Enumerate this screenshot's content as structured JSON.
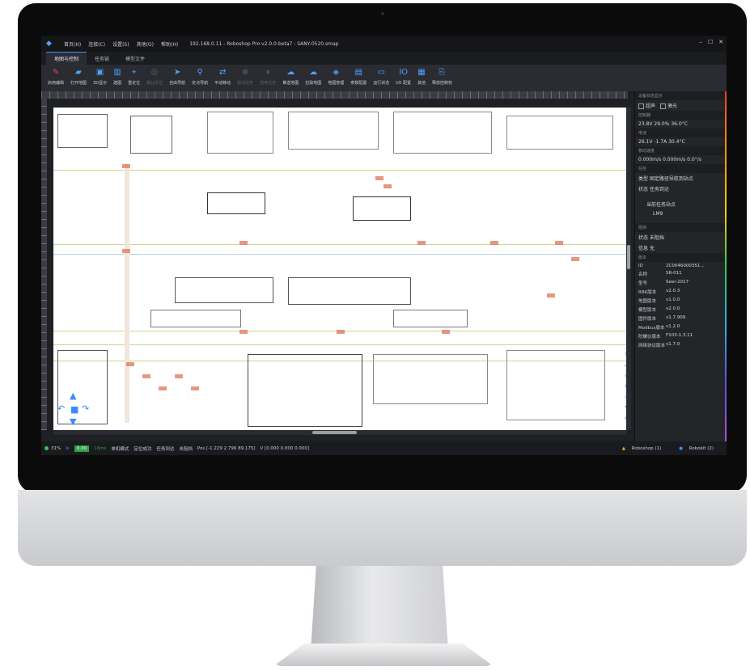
{
  "window": {
    "menus": [
      "首页(H)",
      "连接(C)",
      "设置(S)",
      "其他(O)",
      "帮助(H)"
    ],
    "title": "192.168.0.11 - Roboshop Pro v2.0.0-beta7 : SANY-0520.smap",
    "controls": [
      "–",
      "☐",
      "✕"
    ]
  },
  "tabs": [
    "地图与控制",
    "任务链",
    "模型文件"
  ],
  "toolbar": [
    {
      "label": "启用编辑",
      "icon": "pencil-icon"
    },
    {
      "label": "打开地图",
      "icon": "folder-icon"
    },
    {
      "label": "3D显示",
      "icon": "3d-icon"
    },
    {
      "label": "建图",
      "icon": "map-build-icon"
    },
    {
      "label": "重定位",
      "icon": "relocate-icon"
    },
    {
      "label": "确认定位",
      "icon": "confirm-icon"
    },
    {
      "label": "自由导航",
      "icon": "navigate-icon"
    },
    {
      "label": "定点导航",
      "icon": "pin-icon"
    },
    {
      "label": "平动移动",
      "icon": "move-icon"
    },
    {
      "label": "取消任务",
      "icon": "cancel-icon"
    },
    {
      "label": "暂停任务",
      "icon": "pause-icon"
    },
    {
      "label": "推送地图",
      "icon": "upload-icon"
    },
    {
      "label": "拉取地图",
      "icon": "download-icon"
    },
    {
      "label": "地图管理",
      "icon": "layers-icon"
    },
    {
      "label": "参数配置",
      "icon": "params-icon"
    },
    {
      "label": "运行状态",
      "icon": "monitor-icon"
    },
    {
      "label": "I/O 配置",
      "icon": "io-icon"
    },
    {
      "label": "其他",
      "icon": "grid-icon"
    },
    {
      "label": "释放控制权",
      "icon": "release-icon"
    }
  ],
  "panel": {
    "device_title": "设备状态显示",
    "checks": [
      "超声",
      "激光"
    ],
    "controller_title": "控制器",
    "controller": "23.8V   29.0%   36.0°C",
    "battery_title": "电池",
    "battery": "26.1V   -1.7A   30.4°C",
    "speed_title": "移动速度",
    "speed": "0.000m/s  0.000m/s  0.0°/s",
    "task_title": "任务",
    "task_type": "类型  固定路径导航到站点",
    "task_state": "状态  任务到达",
    "target_label": "当前任务站点",
    "target_value": "LM9",
    "block_title": "阻挡",
    "block_state": "状态  未阻挡",
    "block_info": "信息  无",
    "version_title": "版本",
    "versions": [
      {
        "k": "ID",
        "v": "2C0046000351..."
      },
      {
        "k": "名称",
        "v": "SR-011"
      },
      {
        "k": "型号",
        "v": "Seer-2017"
      },
      {
        "k": "RBK版本",
        "v": "v2.0.3"
      },
      {
        "k": "地图版本",
        "v": "v1.0.0"
      },
      {
        "k": "模型版本",
        "v": "v2.0.0"
      },
      {
        "k": "固件版本",
        "v": "v1.7.909"
      },
      {
        "k": "Modbus版本",
        "v": "v1.2.0"
      },
      {
        "k": "陀螺仪版本",
        "v": "F103-1.3.11"
      },
      {
        "k": "网络协议版本",
        "v": "v1.7.0"
      }
    ]
  },
  "status": {
    "battery": "31%",
    "speed_badge": "0.00",
    "latency": "16ms",
    "mode": "单机模式",
    "loc": "定位成功",
    "task": "任务到达",
    "block": "未阻挡",
    "pos": "Pos [-1.229  2.796  89.175]",
    "vel": "V [0.000  0.000  0.000]",
    "roboshop": "Roboshop (1)",
    "robokit": "Robokit (2)"
  }
}
